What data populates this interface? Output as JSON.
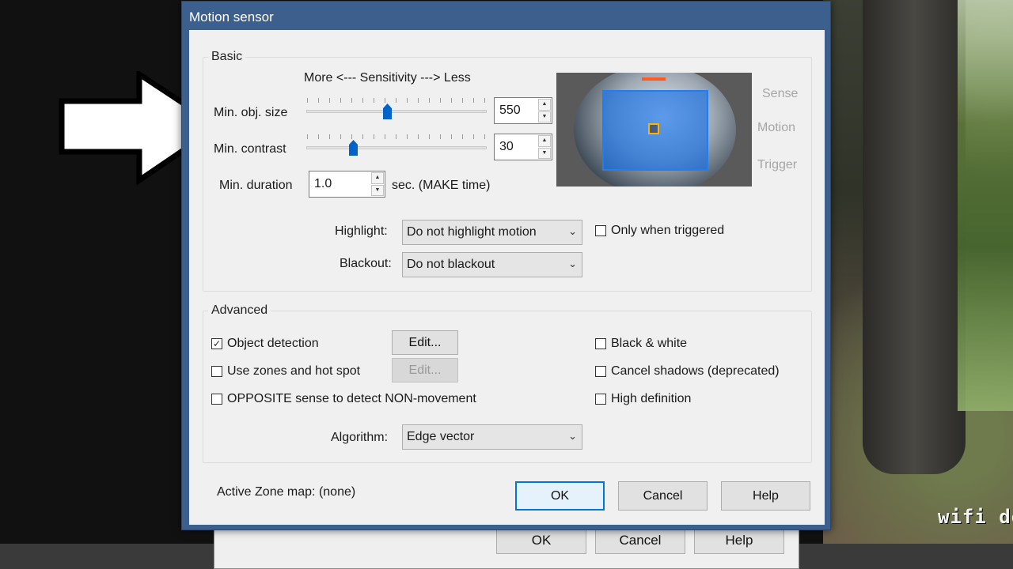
{
  "dialog": {
    "title": "Motion sensor"
  },
  "basic": {
    "group_label": "Basic",
    "sensitivity_caption": "More <--- Sensitivity ---> Less",
    "min_obj_size": {
      "label": "Min. obj. size",
      "value": "550",
      "slider_fraction": 0.45
    },
    "min_contrast": {
      "label": "Min. contrast",
      "value": "30",
      "slider_fraction": 0.26
    },
    "min_duration": {
      "label": "Min. duration",
      "value": "1.0",
      "unit": "sec.  (MAKE time)"
    },
    "indicators": [
      "Sense",
      "Motion",
      "Trigger"
    ],
    "highlight": {
      "label": "Highlight:",
      "value": "Do not highlight motion"
    },
    "only_when_triggered": {
      "label": "Only when triggered",
      "checked": false
    },
    "blackout": {
      "label": "Blackout:",
      "value": "Do not blackout"
    }
  },
  "advanced": {
    "group_label": "Advanced",
    "object_detection": {
      "label": "Object detection",
      "checked": true,
      "edit_label": "Edit...",
      "edit_enabled": true
    },
    "use_zones": {
      "label": "Use zones and hot spot",
      "checked": false,
      "edit_label": "Edit...",
      "edit_enabled": false
    },
    "opposite_sense": {
      "label": "OPPOSITE sense to detect NON-movement",
      "checked": false
    },
    "black_white": {
      "label": "Black & white",
      "checked": false
    },
    "cancel_shadows": {
      "label": "Cancel shadows (deprecated)",
      "checked": false
    },
    "high_definition": {
      "label": "High definition",
      "checked": false
    },
    "algorithm": {
      "label": "Algorithm:",
      "value": "Edge vector"
    }
  },
  "footer": {
    "active_zone_label": "Active Zone map:",
    "active_zone_value": "(none)",
    "ok": "OK",
    "cancel": "Cancel",
    "help": "Help"
  },
  "parent_dialog": {
    "ok": "OK",
    "cancel": "Cancel",
    "help": "Help"
  },
  "background": {
    "overlay_text": "wifi do"
  },
  "icons": {
    "pointer_arrow": "arrow-icon",
    "spin_up": "▲",
    "spin_down": "▼",
    "dropdown": "⌄",
    "check_mark": "☑"
  },
  "colors": {
    "title_bar": "#3d5f8e",
    "slider_thumb": "#0063c9",
    "motion_highlight": "#1d7ff5",
    "primary_button_border": "#0078d7"
  }
}
